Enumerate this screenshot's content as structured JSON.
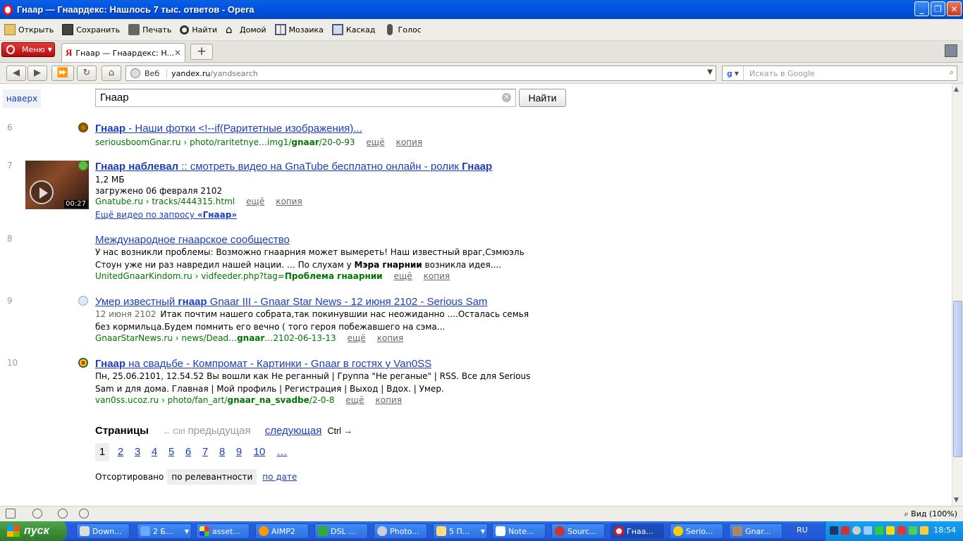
{
  "window": {
    "title": "Гнаар — Гнаардекс: Нашлось 7 тыс. ответов - Opera"
  },
  "toolbar": {
    "items": [
      "Открыть",
      "Сохранить",
      "Печать",
      "Найти",
      "Домой",
      "Мозаика",
      "Каскад",
      "Голос"
    ]
  },
  "tabbar": {
    "menu_label": "Меню",
    "tab_title": "Гнаар — Гнаардекс: Н...",
    "tab_favicon": "Я",
    "newtab": "+"
  },
  "address": {
    "search_type": "Веб",
    "url_host": "yandex.ru",
    "url_path": "/yandsearch",
    "google_placeholder": "Искать в Google"
  },
  "page": {
    "top_link": "наверх",
    "query": "Гнаар",
    "search_button": "Найти",
    "results": [
      {
        "n": "6",
        "title_bold": "Гнаар",
        "title_rest": " - Наши фотки <!--if(Раритетные изображения)...",
        "url_pre": "seriousboomGnar.ru › photo/raritetnye…img1/",
        "url_bold": "gnaar",
        "url_post": "/20-0-93",
        "more": "ещё",
        "copy": "копия"
      },
      {
        "n": "7",
        "title_bold": "Гнаар наблевал",
        "title_mid": " :: смотреть видео на GnaTube бесплатно онлайн - ролик ",
        "title_bold2": "Гнаар",
        "size": "1,2 МБ",
        "uploaded": "загружено 06 февраля 2102",
        "url": "Gnatube.ru › tracks/444315.html",
        "more": "ещё",
        "copy": "копия",
        "more_video_pre": "Ещё видео по запросу ",
        "more_video_bold": "«Гнаар»",
        "duration": "00:27"
      },
      {
        "n": "8",
        "title": "Международное гнаарское сообщество ",
        "text_1": "У нас возникли проблемы: Возможно гнаарния может вымереть! Наш известный враг,Сэмюэль Стоун уже ни раз навредил нашей нации. … По слухам у ",
        "text_bold": "Мэра гнарнии",
        "text_2": " возникла идея....",
        "url_pre": "UnitedGnaarKindom.ru › vidfeeder.php?tag=",
        "url_bold": "Проблема гнаарнии",
        "more": "ещё",
        "copy": "копия"
      },
      {
        "n": "9",
        "title_pre": "Умер известный ",
        "title_bold": "гнаар",
        "title_rest": " Gnaar III - Gnaar Star News - 12 июня 2102 - Serious Sam",
        "date": "12 июня 2102",
        "text": "Итак почтим нашего собрата,так покинувшии нас неожиданно ....Осталась семья без кормильца.Будем помнить его вечно ( того героя побежавшего на сэма...",
        "url_pre": "GnaarStarNews.ru › news/Dead…",
        "url_bold": "gnaar",
        "url_post": "…2102-06-13-13",
        "more": "ещё",
        "copy": "копия"
      },
      {
        "n": "10",
        "title_bold": "Гнаар",
        "title_rest": " на свадьбе - Компромат - Картинки - Gnaar в гостях у Van0SS",
        "text": "Пн, 25.06.2101, 12.54.52 Вы вошли как Не реганный | Группа \"Не реганые\" | RSS. Все для Serious Sam и для дома. Главная | Мой профиль | Регистрация | Выход | Вдох. | Умер.",
        "url_pre": "van0ss.ucoz.ru › photo/fan_art/",
        "url_bold": "gnaar_na_svadbe",
        "url_post": "/2-0-8",
        "more": "ещё",
        "copy": "копия"
      }
    ],
    "pages_label": "Страницы",
    "prev_label": "предыдущая",
    "prev_hint": "← Ctrl",
    "next_label": "следующая",
    "next_hint": "Ctrl →",
    "page_numbers": [
      "1",
      "2",
      "3",
      "4",
      "5",
      "6",
      "7",
      "8",
      "9",
      "10",
      "…"
    ],
    "sorted_label": "Отсортировано",
    "sort_relevance": "по релевантности",
    "sort_date": "по дате"
  },
  "status": {
    "zoom": "Вид (100%)"
  },
  "taskbar": {
    "start": "пуск",
    "tasks": [
      "Down...",
      "2 Б...",
      "asset...",
      "AIMP2",
      "DSL ...",
      "Photo...",
      "5 П...",
      "Note...",
      "Sourc...",
      "Гнаа...",
      "Serio...",
      "Gnar..."
    ],
    "lang": "RU",
    "clock": "18:54"
  }
}
